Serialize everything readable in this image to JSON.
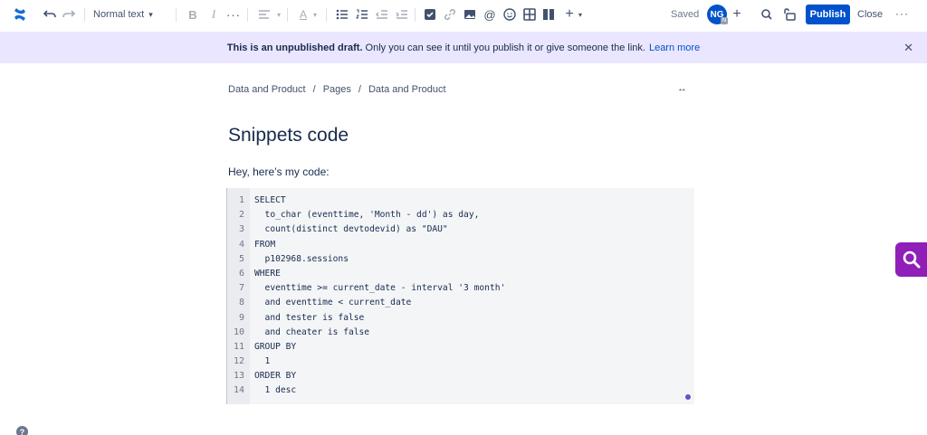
{
  "toolbar": {
    "text_style": "Normal text",
    "saved_label": "Saved",
    "avatar_initials": "NG",
    "avatar_badge": "N",
    "publish_label": "Publish",
    "close_label": "Close",
    "accent_color": "#0052cc",
    "icons": [
      "confluence-logo-icon",
      "undo-icon",
      "redo-icon",
      "chevron-down-icon",
      "bold-icon",
      "italic-icon",
      "more-formatting-icon",
      "align-icon",
      "text-color-icon",
      "bullet-list-icon",
      "numbered-list-icon",
      "outdent-icon",
      "indent-icon",
      "task-icon",
      "link-icon",
      "image-icon",
      "mention-icon",
      "emoji-icon",
      "table-icon",
      "layout-icon",
      "insert-icon",
      "add-collaborator-icon",
      "search-icon",
      "restrictions-icon",
      "more-icon"
    ]
  },
  "banner": {
    "bold_text": "This is an unpublished draft.",
    "text": " Only you can see it until you publish it or give someone the link.",
    "link": "Learn more",
    "background": "#eae6ff"
  },
  "breadcrumb": [
    "Data and Product",
    "/",
    "Pages",
    "/",
    "Data and Product"
  ],
  "page": {
    "title": "Snippets code",
    "intro": "Hey, here’s my code:"
  },
  "code": {
    "line_numbers": [
      "1",
      "2",
      "3",
      "4",
      "5",
      "6",
      "7",
      "8",
      "9",
      "10",
      "11",
      "12",
      "13",
      "14"
    ],
    "lines": [
      "SELECT",
      "  to_char (eventtime, 'Month - dd') as day,",
      "  count(distinct devtodevid) as \"DAU\"",
      "FROM",
      "  p102968.sessions",
      "WHERE",
      "  eventtime >= current_date - interval '3 month'",
      "  and eventtime < current_date",
      "  and tester is false",
      "  and cheater is false",
      "GROUP BY",
      "  1",
      "ORDER BY",
      "  1 desc"
    ]
  },
  "help_label": "?"
}
